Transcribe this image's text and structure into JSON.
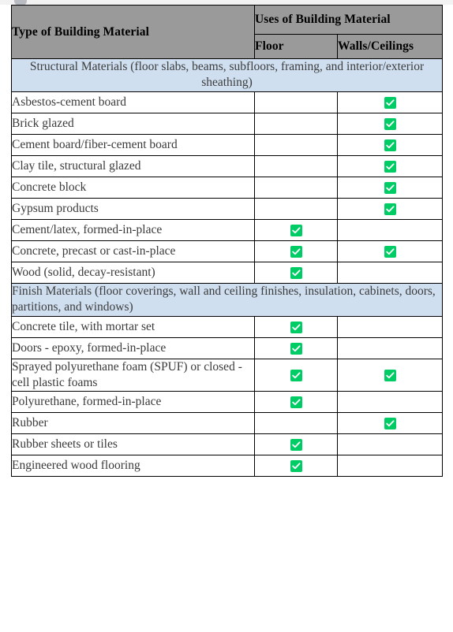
{
  "table": {
    "header": {
      "col_material": "Type of Building Material",
      "col_uses": "Uses of Building Material",
      "col_floor": "Floor",
      "col_walls": "Walls/Ceilings"
    },
    "sections": [
      {
        "title": "Structural Materials (floor slabs, beams, subfloors, framing, and interior/exterior sheathing)",
        "align": "center",
        "rows": [
          {
            "material": "Asbestos-cement board",
            "floor": false,
            "walls": true
          },
          {
            "material": "Brick glazed",
            "floor": false,
            "walls": true
          },
          {
            "material": "Cement board/fiber-cement board",
            "floor": false,
            "walls": true
          },
          {
            "material": "Clay tile, structural glazed",
            "floor": false,
            "walls": true
          },
          {
            "material": "Concrete block",
            "floor": false,
            "walls": true
          },
          {
            "material": "Gypsum products",
            "floor": false,
            "walls": true
          },
          {
            "material": "Cement/latex, formed-in-place",
            "floor": true,
            "walls": false
          },
          {
            "material": "Concrete, precast or cast-in-place",
            "floor": true,
            "walls": true
          },
          {
            "material": "Wood (solid, decay-resistant)",
            "floor": true,
            "walls": false
          }
        ]
      },
      {
        "title": "Finish Materials (floor coverings, wall and ceiling finishes, insulation, cabinets, doors, partitions, and windows)",
        "align": "left",
        "rows": [
          {
            "material": "Concrete tile, with mortar set",
            "floor": true,
            "walls": false
          },
          {
            "material": "Doors - epoxy, formed-in-place",
            "floor": true,
            "walls": false
          },
          {
            "material": "Sprayed polyurethane foam (SPUF) or closed -cell plastic foams",
            "floor": true,
            "walls": true
          },
          {
            "material": "Polyurethane, formed-in-place",
            "floor": true,
            "walls": false
          },
          {
            "material": "Rubber",
            "floor": false,
            "walls": true
          },
          {
            "material": "Rubber sheets or tiles",
            "floor": true,
            "walls": false
          },
          {
            "material": "Engineered wood flooring",
            "floor": true,
            "walls": false
          }
        ]
      }
    ],
    "icon": "checkbox-checked-icon",
    "colors": {
      "header_bg": "#9a9a9a",
      "section_bg": "#cfdff0",
      "check_green": "#00cc66",
      "border": "#000000",
      "text": "#3a3a3a"
    }
  }
}
